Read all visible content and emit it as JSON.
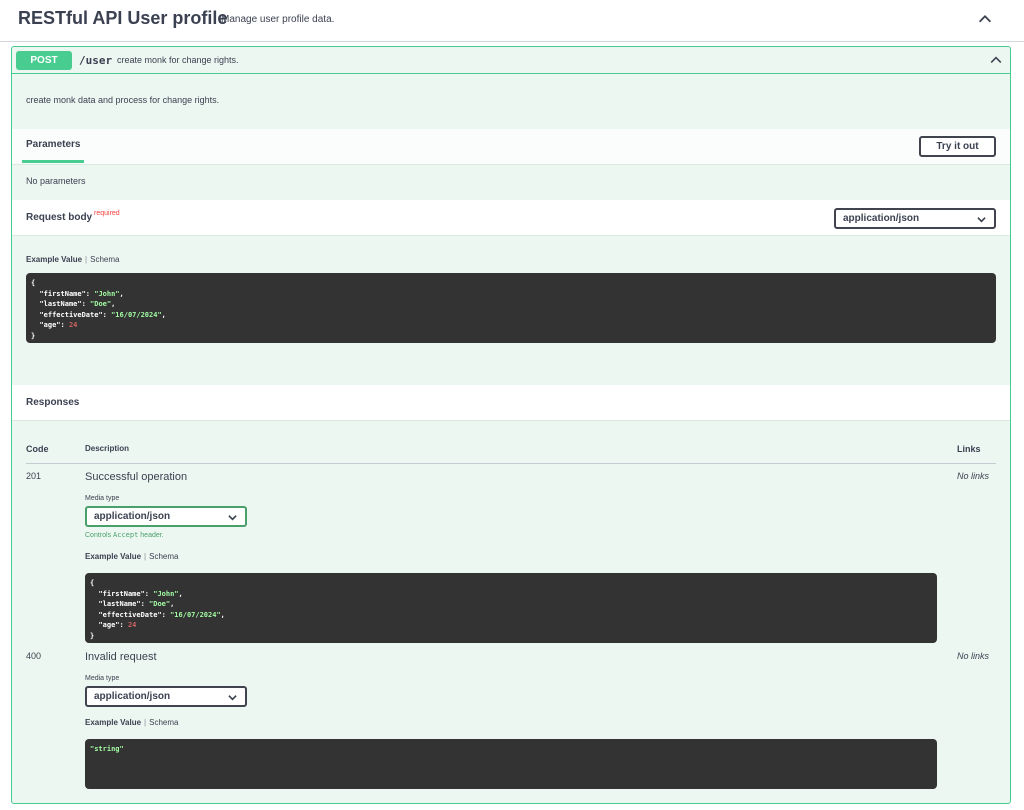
{
  "tag": {
    "title": "RESTful API User profile",
    "description": "Manage user profile data."
  },
  "operation": {
    "method": "POST",
    "path": "/user",
    "summary": "create monk for change rights.",
    "description": "create monk data and process for change rights."
  },
  "parameters": {
    "tab_label": "Parameters",
    "try_button": "Try it out",
    "empty_text": "No parameters"
  },
  "request_body": {
    "label": "Request body",
    "required_label": "required",
    "content_type": "application/json",
    "example_tab": "Example Value",
    "schema_tab": "Schema"
  },
  "responses": {
    "label": "Responses",
    "columns": {
      "code": "Code",
      "description": "Description",
      "links": "Links"
    },
    "items": [
      {
        "code": "201",
        "description": "Successful operation",
        "links": "No links",
        "media_label": "Media type",
        "media_type": "application/json",
        "controls_prefix": "Controls",
        "controls_code": "Accept",
        "controls_suffix": "header.",
        "example_tab": "Example Value",
        "schema_tab": "Schema"
      },
      {
        "code": "400",
        "description": "Invalid request",
        "links": "No links",
        "media_label": "Media type",
        "media_type": "application/json",
        "example_tab": "Example Value",
        "schema_tab": "Schema",
        "example_string": "\"string\""
      }
    ]
  },
  "example": {
    "open": "{",
    "close": "}",
    "fields": [
      {
        "key": "\"firstName\"",
        "value": "\"John\"",
        "kind": "string"
      },
      {
        "key": "\"lastName\"",
        "value": "\"Doe\"",
        "kind": "string"
      },
      {
        "key": "\"effectiveDate\"",
        "value": "\"16/07/2024\"",
        "kind": "string"
      },
      {
        "key": "\"age\"",
        "value": "24",
        "kind": "number"
      }
    ]
  },
  "icons": {
    "collapse": "chevron-up-icon",
    "dropdown": "chevron-down-icon"
  },
  "colors": {
    "post_green": "#49cc90",
    "block_bg": "#edf7f1",
    "code_bg": "#333333",
    "required_red": "#f93e3e"
  }
}
